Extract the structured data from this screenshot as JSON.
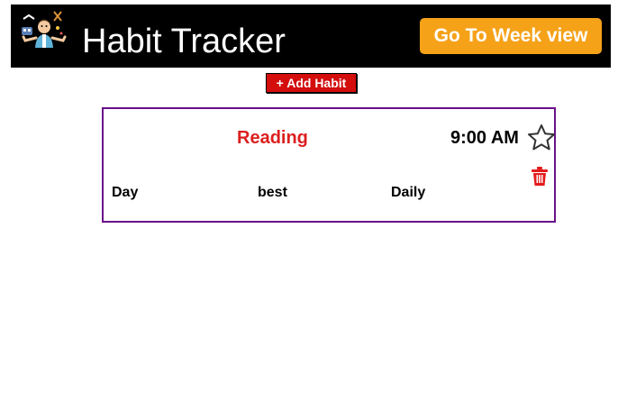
{
  "header": {
    "title": "Habit Tracker",
    "week_view_label": "Go To Week view",
    "logo_icon": "person-juggling-icon",
    "background_color": "#000000",
    "week_button_color": "#f5a219"
  },
  "actions": {
    "add_habit_label": "+ Add Habit",
    "add_button_color": "#d40d0d"
  },
  "habits": [
    {
      "name": "Reading",
      "time": "9:00 AM",
      "frequency_type": "Day",
      "note": "best",
      "frequency": "Daily",
      "favorite": false,
      "star_icon": "star-outline-icon",
      "delete_icon": "trash-icon",
      "name_color": "#dd1f1f",
      "border_color": "#6a0f8a"
    }
  ]
}
